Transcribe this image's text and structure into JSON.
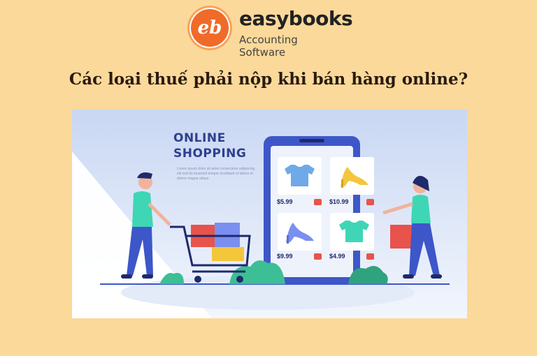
{
  "brand": {
    "badge": "eb",
    "name": "easybooks",
    "tagline": "Accounting Software"
  },
  "headline": "Các loại thuế phải nộp khi bán hàng online?",
  "banner": {
    "title_line1": "ONLINE",
    "title_line2": "SHOPPING",
    "subtext": "Lorem ipsum dolor sit amet consectetur adipiscing elit sed do eiusmod tempor incididunt ut labore et dolore magna aliqua"
  },
  "products": [
    {
      "icon": "tshirt-icon",
      "price": "$5.99"
    },
    {
      "icon": "high-heel-icon",
      "price": "$10.99"
    },
    {
      "icon": "high-heel-icon",
      "price": "$9.99"
    },
    {
      "icon": "tshirt-icon",
      "price": "$4.99"
    }
  ],
  "colors": {
    "page_bg": "#fbd99a",
    "brand_orange": "#f06b2a",
    "phone_blue": "#3d57c9",
    "sky_blue": "#e6edfa",
    "accent_red": "#e8534c"
  }
}
